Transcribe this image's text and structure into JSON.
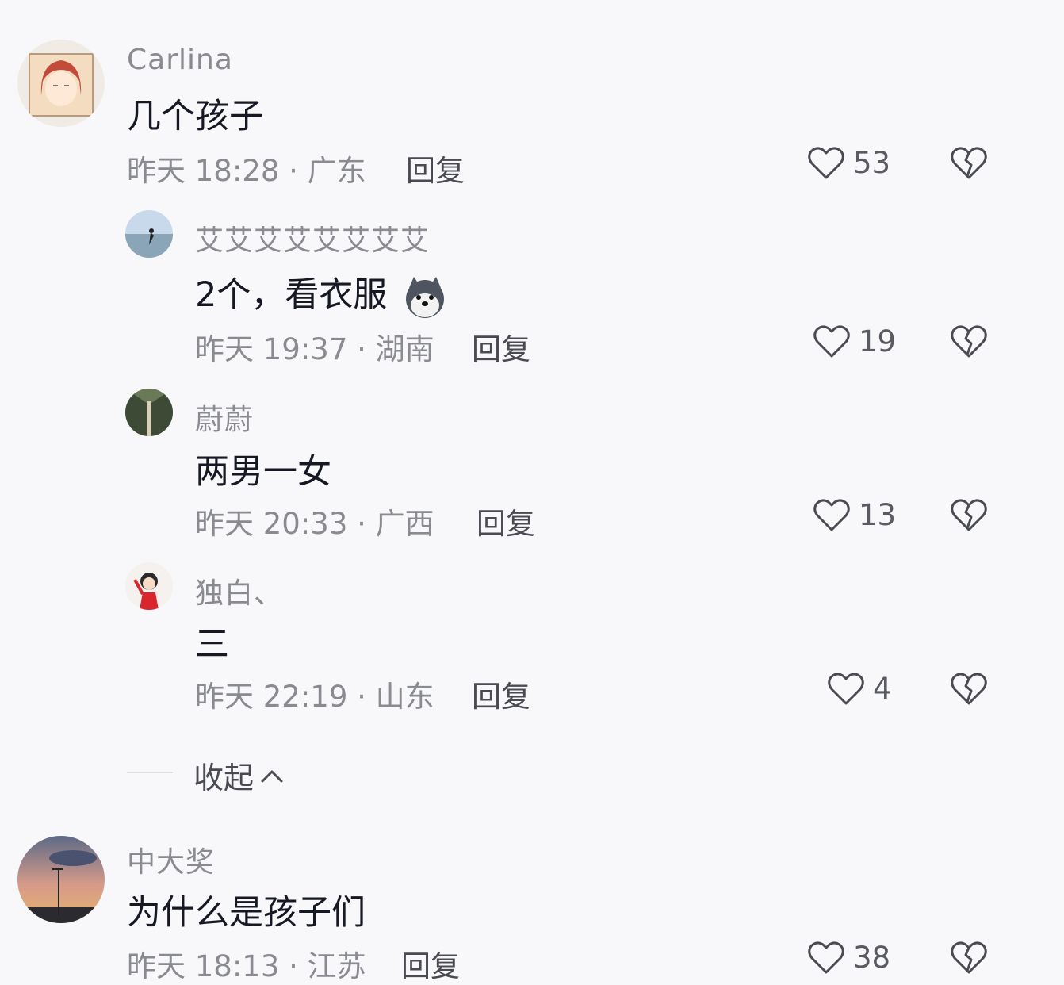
{
  "comments": [
    {
      "name": "Carlina",
      "text": "几个孩子",
      "meta": "昨天 18:28 · 广东",
      "reply": "回复",
      "likes": "53",
      "avatar_icon": "cartoon-girl-avatar"
    },
    {
      "name": "艾艾艾艾艾艾艾艾",
      "text": "2个，看衣服",
      "emoji_icon": "husky-dog-emoji",
      "meta": "昨天 19:37 · 湖南",
      "reply": "回复",
      "likes": "19",
      "avatar_icon": "seaside-photo-avatar"
    },
    {
      "name": "蔚蔚",
      "text": "两男一女",
      "meta": "昨天 20:33 · 广西",
      "reply": "回复",
      "likes": "13",
      "avatar_icon": "tree-photo-avatar"
    },
    {
      "name": "独白、",
      "text": "三",
      "meta": "昨天 22:19 · 山东",
      "reply": "回复",
      "likes": "4",
      "avatar_icon": "red-dress-girl-avatar"
    },
    {
      "name": "中大奖",
      "text": "为什么是孩子们",
      "meta": "昨天 18:13 · 江苏",
      "reply": "回复",
      "likes": "38",
      "avatar_icon": "sunset-sky-avatar"
    }
  ],
  "collapse_label": "收起",
  "colors": {
    "background": "#f8f8fa",
    "secondary_text": "#8a8b91",
    "primary_text": "#161823"
  }
}
